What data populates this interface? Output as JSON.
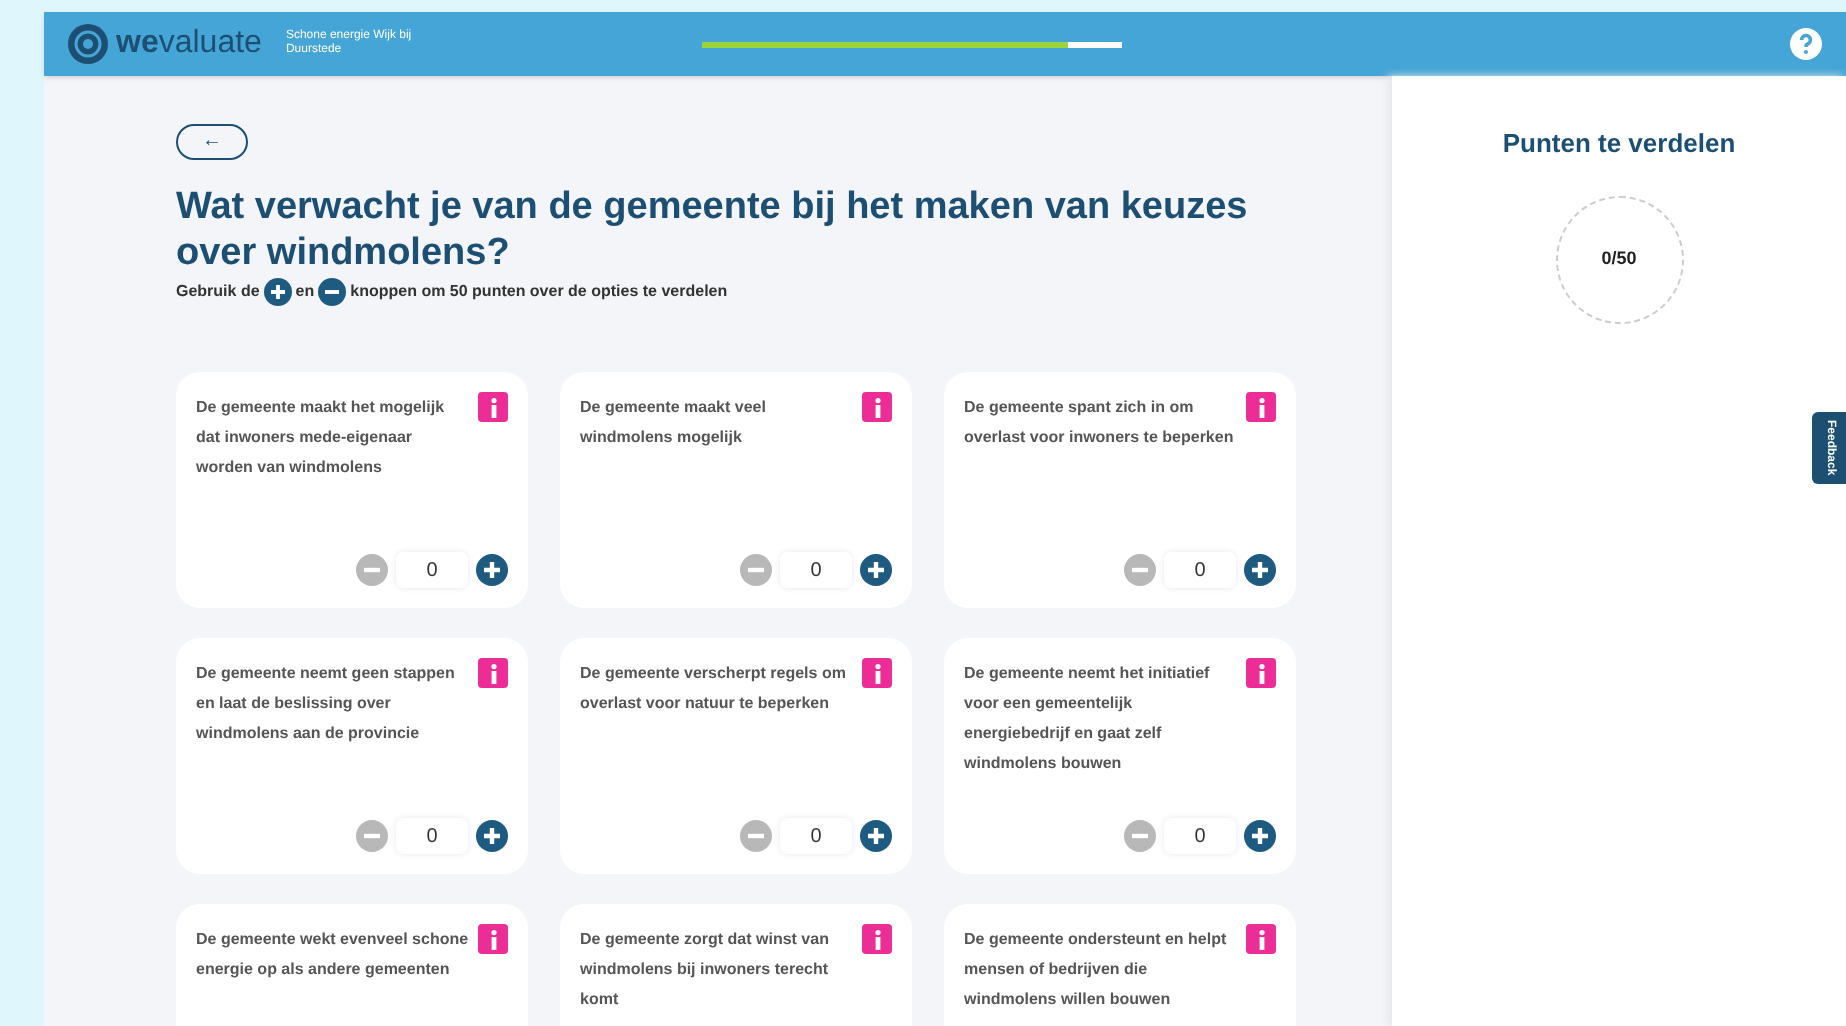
{
  "header": {
    "brand_strong": "we",
    "brand_light": "valuate",
    "subtitle": "Schone energie Wijk bij Duurstede",
    "progress": {
      "level": 0.87
    }
  },
  "back_button": {
    "label": "←"
  },
  "title": "Wat verwacht je van de gemeente bij het maken van keuzes over windmolens?",
  "instruction": {
    "before": "Gebruik de",
    "middle": "en",
    "after": "knoppen om 50 punten over de opties te verdelen"
  },
  "options": [
    {
      "text": "De gemeente maakt het mogelijk dat inwoners mede-eigenaar worden van windmolens",
      "value": "0",
      "minus_disabled": true
    },
    {
      "text": "De gemeente maakt veel windmolens mogelijk",
      "value": "0",
      "minus_disabled": true
    },
    {
      "text": "De gemeente spant zich in om overlast voor inwoners te beperken",
      "value": "0",
      "minus_disabled": true
    },
    {
      "text": "De gemeente neemt geen stappen en laat de beslissing over windmolens aan de provincie",
      "value": "0",
      "minus_disabled": true
    },
    {
      "text": "De gemeente verscherpt regels om overlast voor natuur te beperken",
      "value": "0",
      "minus_disabled": true
    },
    {
      "text": "De gemeente neemt het initiatief voor een gemeentelijk energiebedrijf en gaat zelf windmolens bouwen",
      "value": "0",
      "minus_disabled": true
    },
    {
      "text": "De gemeente wekt evenveel schone energie op als andere gemeenten"
    },
    {
      "text": "De gemeente zorgt dat winst van windmolens bij inwoners terecht komt"
    },
    {
      "text": "De gemeente ondersteunt en helpt mensen of bedrijven die windmolens willen bouwen"
    }
  ],
  "sidebar": {
    "title": "Punten te verdelen",
    "counter": "0/50",
    "feedback_tab": "Feedback"
  }
}
